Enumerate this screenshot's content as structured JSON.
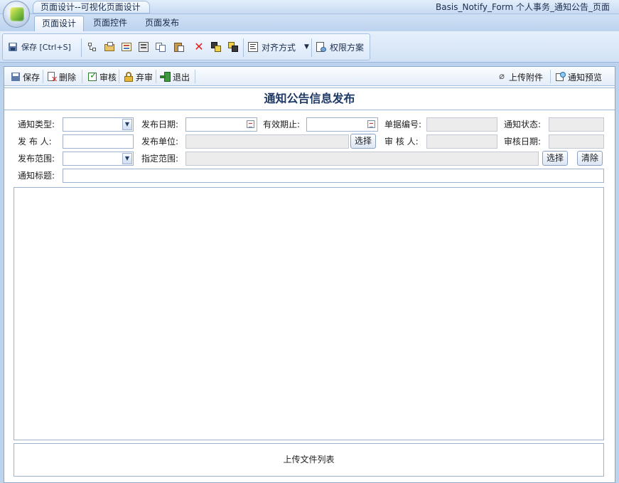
{
  "app": {
    "title_tab": "页面设计--可视化页面设计",
    "doc_title": "Basis_Notify_Form  个人事务_通知公告_页面"
  },
  "ribbon": {
    "tabs": [
      "页面设计",
      "页面控件",
      "页面发布"
    ],
    "save_label": "保存 [Ctrl+S]",
    "align_label": "对齐方式",
    "permission_label": "权限方案"
  },
  "form_toolbar": {
    "save": "保存",
    "delete": "删除",
    "audit": "审核",
    "abandon": "弃审",
    "exit": "退出",
    "upload_attachment": "上传附件",
    "notify_preview": "通知预览"
  },
  "form": {
    "title": "通知公告信息发布",
    "labels": {
      "notify_type": "通知类型:",
      "publish_date": "发布日期:",
      "valid_until": "有效期止:",
      "doc_number": "单据编号:",
      "notify_status": "通知状态:",
      "publisher": "发 布 人:",
      "publish_unit": "发布单位:",
      "reviewer": "审 核 人:",
      "review_date": "审核日期:",
      "publish_scope": "发布范围:",
      "specified_scope": "指定范围:",
      "notify_title": "通知标题:"
    },
    "buttons": {
      "select_unit": "选择",
      "select_scope": "选择",
      "clear_scope": "清除"
    },
    "file_list_label": "上传文件列表"
  },
  "colors": {
    "ribbon_bg": "#bcd3ee",
    "title_text": "#1f3a66",
    "readonly_field": "#ececec"
  }
}
